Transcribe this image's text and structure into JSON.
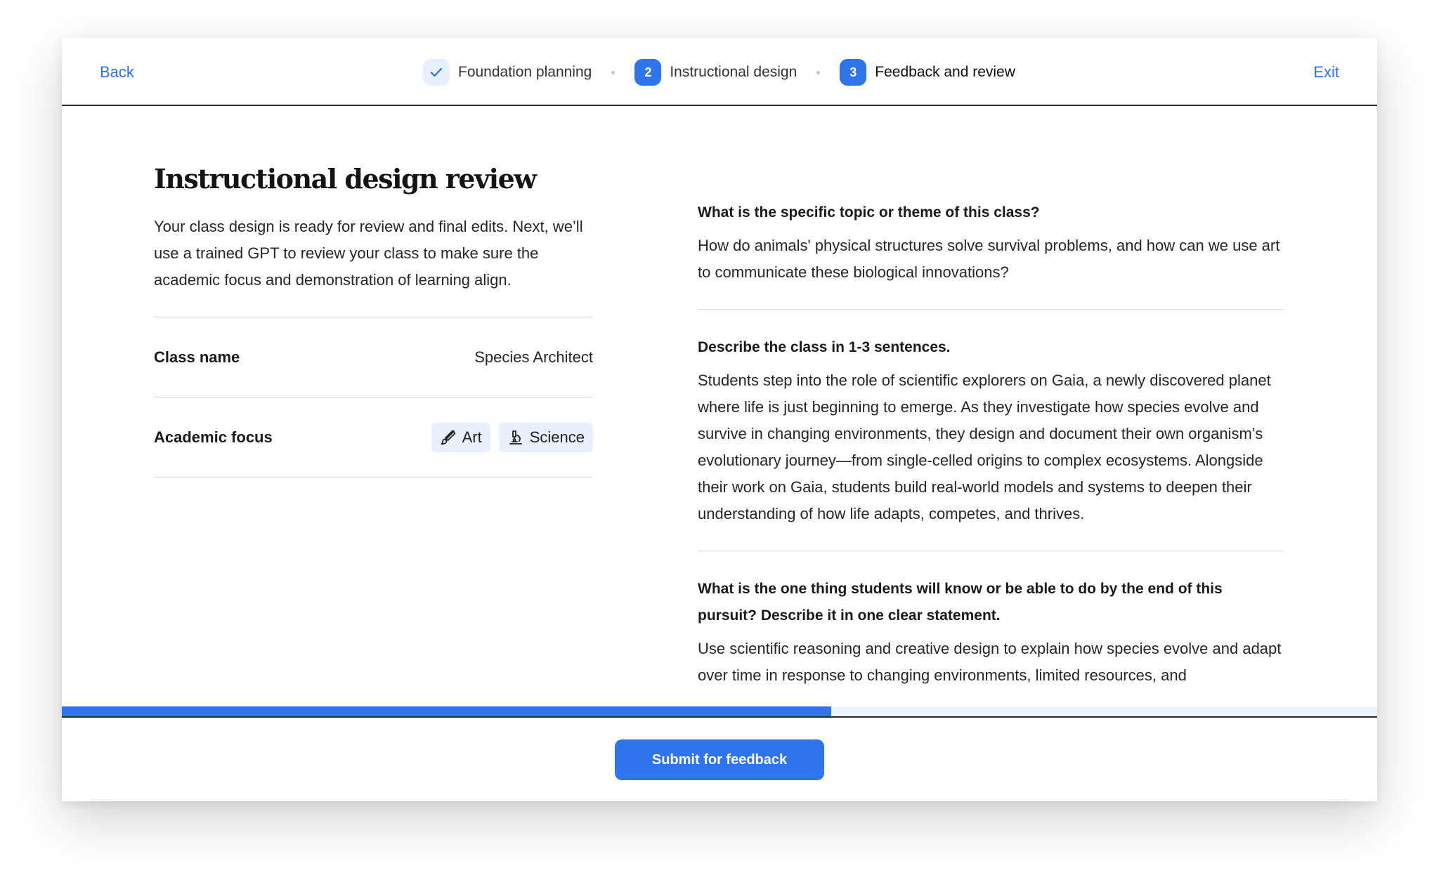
{
  "nav": {
    "back_label": "Back",
    "exit_label": "Exit",
    "steps": [
      {
        "label": "Foundation planning",
        "marker": "check-icon",
        "status": "done"
      },
      {
        "label": "Instructional design",
        "marker": "2",
        "status": "in-progress"
      },
      {
        "label": "Feedback and review",
        "marker": "3",
        "status": "current"
      }
    ]
  },
  "review": {
    "title": "Instructional design review",
    "intro": "Your class design is ready for review and final edits. Next, we’ll use a trained GPT to review your class to make sure the academic focus and demonstration of learning align.",
    "class_name_label": "Class name",
    "class_name_value": "Species Architect",
    "academic_focus_label": "Academic focus",
    "academic_focus_tags": [
      {
        "label": "Art",
        "icon": "paintbrush-icon"
      },
      {
        "label": "Science",
        "icon": "microscope-icon"
      }
    ]
  },
  "questions": [
    {
      "question": "What is the specific topic or theme of this class?",
      "answer": "How do animals' physical structures solve survival problems, and how can we use art to communicate these biological innovations?"
    },
    {
      "question": "Describe the class in 1-3 sentences.",
      "answer": "Students step into the role of scientific explorers on Gaia, a newly discovered planet where life is just beginning to emerge. As they investigate how species evolve and survive in changing environments, they design and document their own organism’s evolutionary journey—from single-celled origins to complex ecosystems. Alongside their work on Gaia, students build real-world models and systems to deepen their understanding of how life adapts, competes, and thrives."
    },
    {
      "question": "What is the one thing students will know or be able to do by the end of this pursuit? Describe it in one clear statement.",
      "answer": "Use scientific reasoning and creative design to explain how species evolve and adapt over time in response to changing environments, limited resources, and"
    }
  ],
  "progress": {
    "fraction": 0.585
  },
  "footer": {
    "submit_label": "Submit for feedback"
  },
  "colors": {
    "accent": "#2f74ea",
    "link": "#2f6fe0",
    "tag_bg": "#eaf0fb"
  }
}
